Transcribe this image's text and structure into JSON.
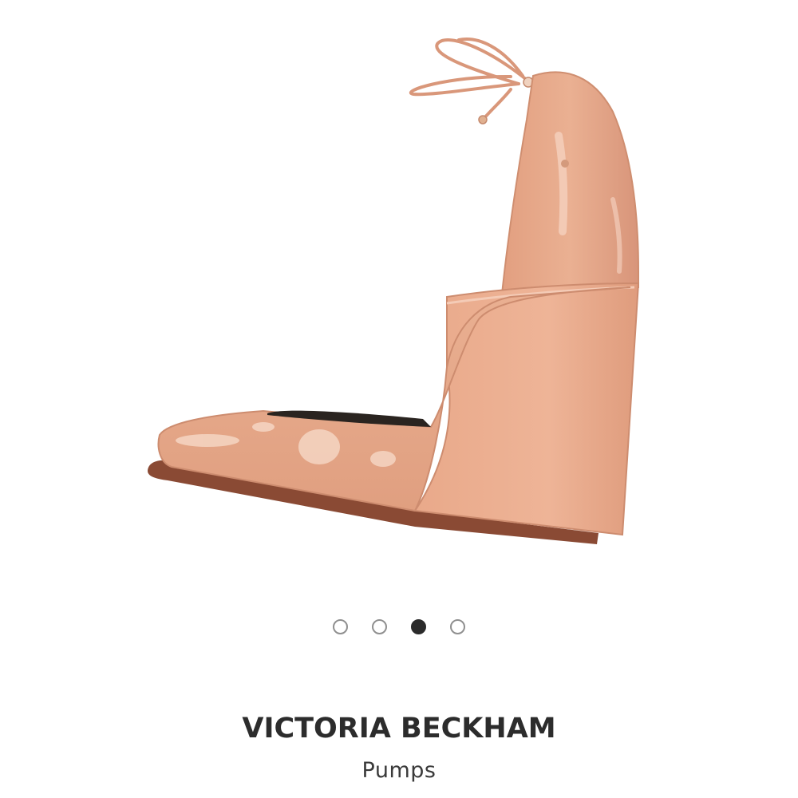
{
  "product": {
    "brand": "VICTORIA BECKHAM",
    "category": "Pumps",
    "image_subject": "shoe-icon",
    "colors": {
      "patent_leather": "#e8a88a",
      "highlight": "#f6d0bd",
      "sole": "#8a4a34",
      "lining": "#2a2420"
    }
  },
  "carousel": {
    "total": 4,
    "active_index": 2,
    "dot_color_active": "#2b2b2b",
    "dot_color_inactive": "#8f8f8f"
  }
}
